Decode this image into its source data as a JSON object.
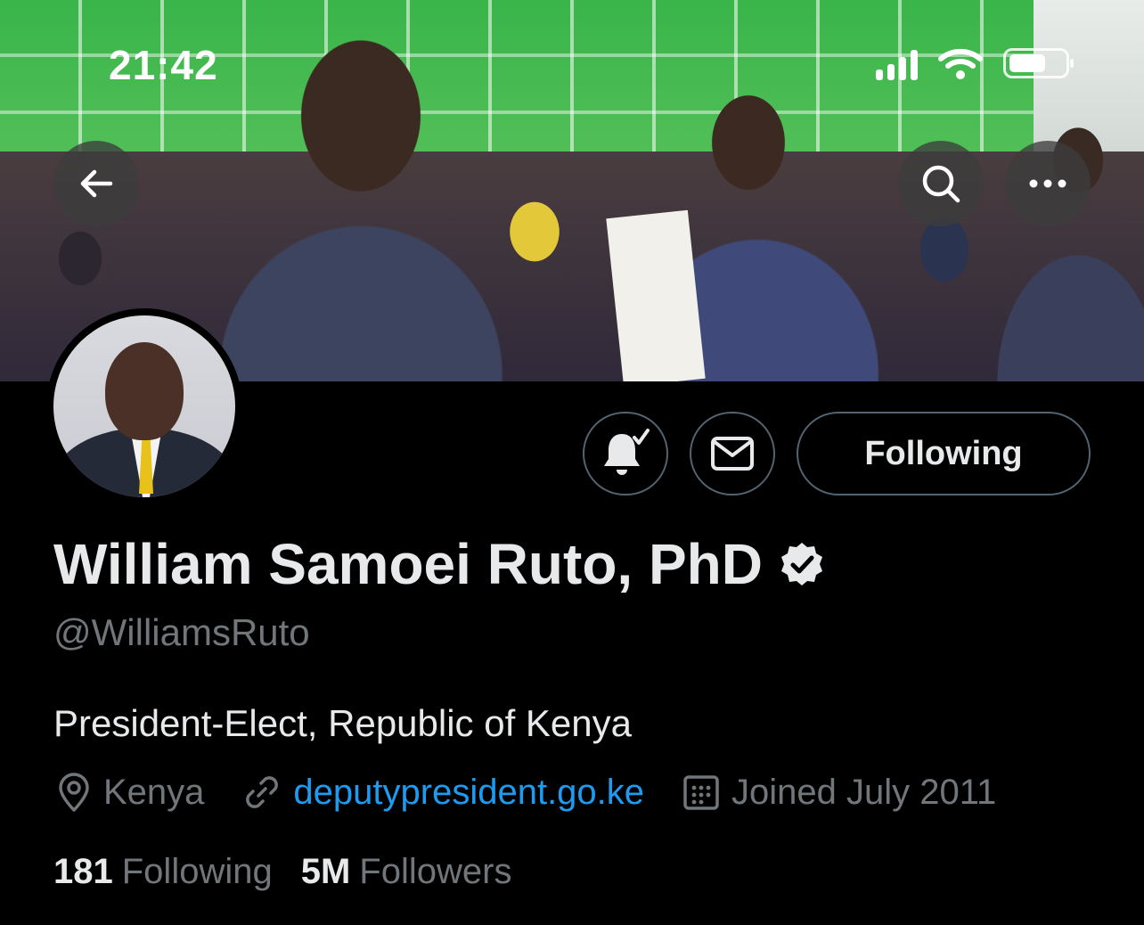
{
  "status_bar": {
    "time": "21:42"
  },
  "header": {
    "back_icon": "arrow-left-icon",
    "search_icon": "search-icon",
    "more_icon": "more-horizontal-icon"
  },
  "profile": {
    "display_name": "William Samoei Ruto, PhD",
    "verified_icon": "verified-badge-icon",
    "handle": "@WilliamsRuto",
    "bio": "President-Elect, Republic of Kenya",
    "location": "Kenya",
    "website": "deputypresident.go.ke",
    "joined": "Joined July 2011"
  },
  "actions": {
    "notifications_icon": "bell-check-icon",
    "message_icon": "mail-icon",
    "follow_label": "Following"
  },
  "stats": {
    "following_count": "181",
    "following_label": "Following",
    "followers_count": "5M",
    "followers_label": "Followers"
  },
  "colors": {
    "background": "#000000",
    "text_primary": "#e7e9ea",
    "text_secondary": "#71767b",
    "link": "#1d9bf0",
    "border": "#536471"
  }
}
